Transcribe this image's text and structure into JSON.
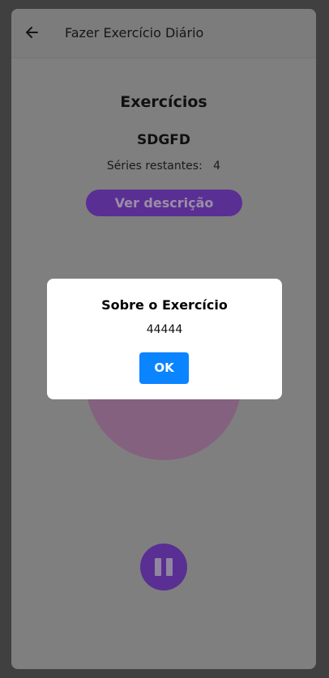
{
  "header": {
    "back_icon": "arrow-left-icon",
    "title": "Fazer Exercício Diário"
  },
  "main": {
    "section_title": "Exercícios",
    "exercise_name": "SDGFD",
    "series_label": "Séries restantes:",
    "series_remaining": "4",
    "description_button": "Ver descrição",
    "pause_icon": "pause-icon"
  },
  "dialog": {
    "title": "Sobre o Exercício",
    "message": "44444",
    "ok_label": "OK"
  },
  "colors": {
    "accent": "#5a2f94",
    "dialog_button": "#0a84ff",
    "overlay_background": "#7f7f7f"
  }
}
